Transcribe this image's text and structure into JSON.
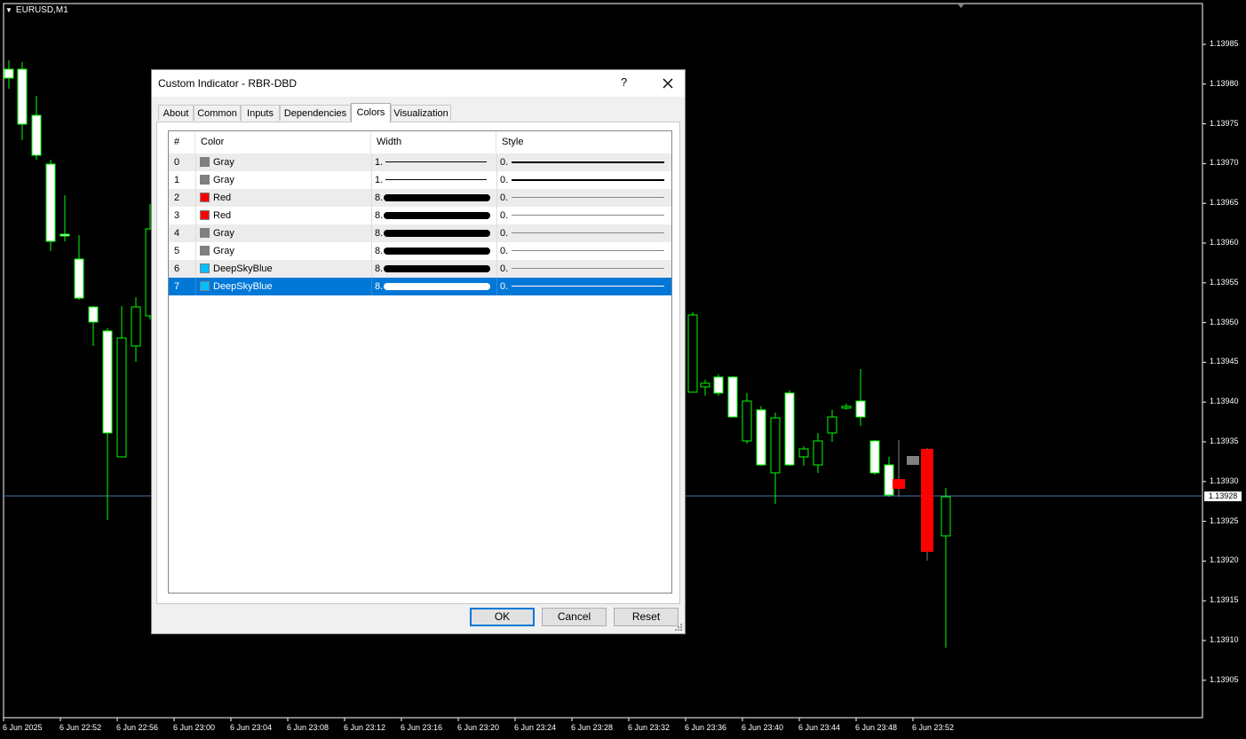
{
  "chart": {
    "symbol": "EURUSD,M1",
    "current_price": "1.13928",
    "price_labels": [
      "1.13985",
      "1.13980",
      "1.13975",
      "1.13970",
      "1.13965",
      "1.13960",
      "1.13955",
      "1.13950",
      "1.13945",
      "1.13940",
      "1.13935",
      "1.13930",
      "1.13925",
      "1.13920",
      "1.13915",
      "1.13910",
      "1.13905"
    ],
    "time_labels": [
      "6 Jun 2025",
      "6 Jun 22:52",
      "6 Jun 22:56",
      "6 Jun 23:00",
      "6 Jun 23:04",
      "6 Jun 23:08",
      "6 Jun 23:12",
      "6 Jun 23:16",
      "6 Jun 23:20",
      "6 Jun 23:24",
      "6 Jun 23:28",
      "6 Jun 23:32",
      "6 Jun 23:36",
      "6 Jun 23:40",
      "6 Jun 23:44",
      "6 Jun 23:48",
      "6 Jun 23:52"
    ],
    "colors": {
      "background": "#000000",
      "bull_body": "#ffffff",
      "wick": "#00ff00",
      "price_line": "#4a6fa5",
      "red": "#ff0000",
      "gray": "#808080"
    }
  },
  "dialog": {
    "title": "Custom Indicator - RBR-DBD",
    "help": "?",
    "tabs": [
      {
        "label": "About"
      },
      {
        "label": "Common"
      },
      {
        "label": "Inputs"
      },
      {
        "label": "Dependencies"
      },
      {
        "label": "Colors",
        "active": true
      },
      {
        "label": "Visualization"
      }
    ],
    "columns": [
      "#",
      "Color",
      "Width",
      "Style"
    ],
    "rows": [
      {
        "index": "0",
        "color_name": "Gray",
        "swatch": "#808080",
        "width": "1.",
        "style": "0.",
        "thick": false
      },
      {
        "index": "1",
        "color_name": "Gray",
        "swatch": "#808080",
        "width": "1.",
        "style": "0.",
        "thick": false
      },
      {
        "index": "2",
        "color_name": "Red",
        "swatch": "#ff0000",
        "width": "8.",
        "style": "0.",
        "thick": true
      },
      {
        "index": "3",
        "color_name": "Red",
        "swatch": "#ff0000",
        "width": "8.",
        "style": "0.",
        "thick": true
      },
      {
        "index": "4",
        "color_name": "Gray",
        "swatch": "#808080",
        "width": "8.",
        "style": "0.",
        "thick": true
      },
      {
        "index": "5",
        "color_name": "Gray",
        "swatch": "#808080",
        "width": "8.",
        "style": "0.",
        "thick": true
      },
      {
        "index": "6",
        "color_name": "DeepSkyBlue",
        "swatch": "#00bfff",
        "width": "8.",
        "style": "0.",
        "thick": true
      },
      {
        "index": "7",
        "color_name": "DeepSkyBlue",
        "swatch": "#00bfff",
        "width": "8.",
        "style": "0.",
        "thick": true,
        "selected": true
      }
    ],
    "buttons": {
      "ok": "OK",
      "cancel": "Cancel",
      "reset": "Reset"
    }
  }
}
